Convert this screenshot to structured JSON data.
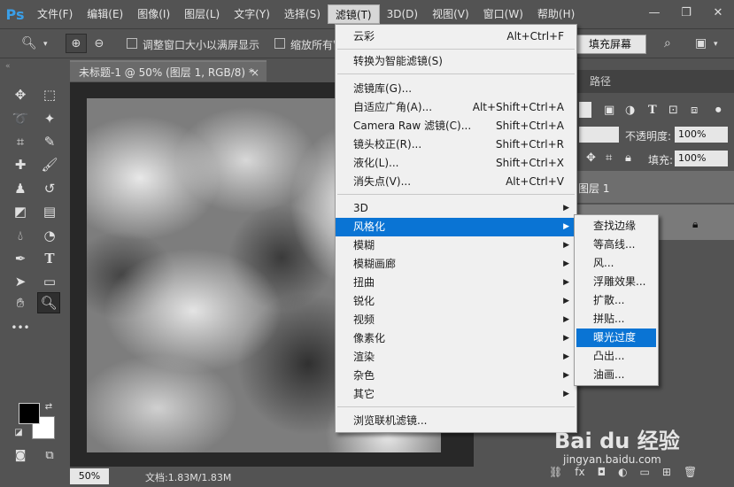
{
  "app": {
    "logo": "Ps"
  },
  "menubar": {
    "items": [
      "文件(F)",
      "编辑(E)",
      "图像(I)",
      "图层(L)",
      "文字(Y)",
      "选择(S)",
      "滤镜(T)",
      "3D(D)",
      "视图(V)",
      "窗口(W)",
      "帮助(H)"
    ],
    "active_index": 6
  },
  "window_controls": {
    "minimize": "—",
    "restore": "❐",
    "close": "✕"
  },
  "options": {
    "resize_windows_label": "调整窗口大小以满屏显示",
    "zoom_all_label": "缩放所有窗",
    "fill_screen_label": "填充屏幕"
  },
  "document": {
    "tab_title": "未标题-1 @ 50% (图层 1, RGB/8) *",
    "close_glyph": "×",
    "zoom_value": "50%",
    "doc_info": "文档:1.83M/1.83M"
  },
  "layers_panel": {
    "tab_paths": "路径",
    "opacity_label": "不透明度:",
    "opacity_value": "100%",
    "fill_label": "填充:",
    "fill_value": "100%",
    "layer_name": "图层 1"
  },
  "filter_menu": {
    "items": [
      {
        "label": "云彩",
        "shortcut": "Alt+Ctrl+F"
      },
      {
        "label": "转换为智能滤镜(S)",
        "shortcut": ""
      },
      {
        "label": "滤镜库(G)...",
        "shortcut": ""
      },
      {
        "label": "自适应广角(A)...",
        "shortcut": "Alt+Shift+Ctrl+A"
      },
      {
        "label": "Camera Raw 滤镜(C)...",
        "shortcut": "Shift+Ctrl+A"
      },
      {
        "label": "镜头校正(R)...",
        "shortcut": "Shift+Ctrl+R"
      },
      {
        "label": "液化(L)...",
        "shortcut": "Shift+Ctrl+X"
      },
      {
        "label": "消失点(V)...",
        "shortcut": "Alt+Ctrl+V"
      },
      {
        "label": "3D",
        "submenu": true
      },
      {
        "label": "风格化",
        "submenu": true,
        "highlighted": true
      },
      {
        "label": "模糊",
        "submenu": true
      },
      {
        "label": "模糊画廊",
        "submenu": true
      },
      {
        "label": "扭曲",
        "submenu": true
      },
      {
        "label": "锐化",
        "submenu": true
      },
      {
        "label": "视频",
        "submenu": true
      },
      {
        "label": "像素化",
        "submenu": true
      },
      {
        "label": "渲染",
        "submenu": true
      },
      {
        "label": "杂色",
        "submenu": true
      },
      {
        "label": "其它",
        "submenu": true
      },
      {
        "label": "浏览联机滤镜..."
      }
    ]
  },
  "stylize_submenu": {
    "items": [
      "查找边缘",
      "等高线...",
      "风...",
      "浮雕效果...",
      "扩散...",
      "拼贴...",
      "曝光过度",
      "凸出...",
      "油画..."
    ],
    "highlighted_index": 6
  },
  "watermark": {
    "text": "Bai du 经验",
    "url": "jingyan.baidu.com"
  },
  "colors": {
    "accent": "#0a74d4",
    "ps_blue": "#3a9fe8",
    "foreground_color": "#000000",
    "background_color": "#ffffff"
  }
}
